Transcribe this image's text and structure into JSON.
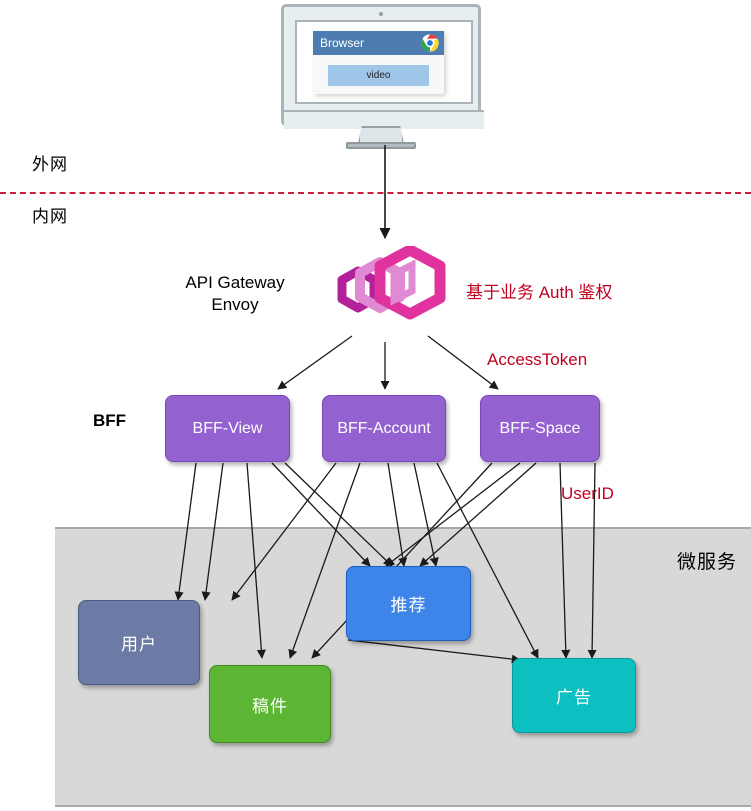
{
  "diagram": {
    "title": "API Gateway / BFF / Microservices architecture",
    "network_zones": {
      "external_label": "外网",
      "internal_label": "内网",
      "divider_color": "#c8203c"
    },
    "client": {
      "browser_title": "Browser",
      "browser_icon": "chrome-logo",
      "content_label": "video",
      "titlebar_color": "#4c7cb0",
      "content_color": "#9fc6e8"
    },
    "gateway": {
      "label_line1": "API Gateway",
      "label_line2": "Envoy",
      "logo_name": "envoy-hexagon-logo",
      "logo_colors": [
        "#b3229b",
        "#e07fd0",
        "#e0339e"
      ],
      "annotation": "基于业务 Auth 鉴权",
      "annotation_color": "#c00020"
    },
    "bff": {
      "row_label": "BFF",
      "node_color": "#9461d0",
      "nodes": [
        {
          "label": "BFF-View"
        },
        {
          "label": "BFF-Account"
        },
        {
          "label": "BFF-Space"
        }
      ],
      "annotations": [
        {
          "text": "AccessToken",
          "color": "#c00020"
        },
        {
          "text": "UserID",
          "color": "#c00020"
        }
      ]
    },
    "microservices": {
      "panel_label": "微服务",
      "panel_color": "#d8d8d8",
      "nodes": [
        {
          "label": "用户",
          "color": "#6c7ba5"
        },
        {
          "label": "推荐",
          "color": "#3d85e8"
        },
        {
          "label": "稿件",
          "color": "#5cb633"
        },
        {
          "label": "广告",
          "color": "#0cbfc0"
        }
      ]
    }
  }
}
